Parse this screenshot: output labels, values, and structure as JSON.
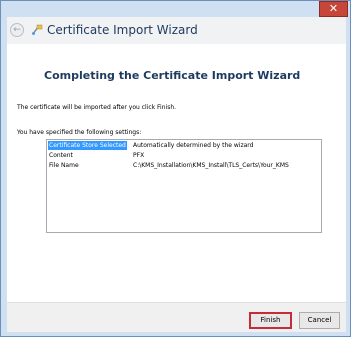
{
  "titlebar": {
    "close_glyph": "✕"
  },
  "header": {
    "back_glyph": "←",
    "title": "Certificate Import Wizard",
    "icon": "certificate-wizard-icon"
  },
  "main": {
    "heading": "Completing the Certificate Import Wizard",
    "info": "The certificate will be imported after you click Finish.",
    "settings_label": "You have specified the following settings:",
    "settings": [
      {
        "name": "Certificate Store Selected",
        "value": "Automatically determined by the wizard"
      },
      {
        "name": "Content",
        "value": "PFX"
      },
      {
        "name": "File Name",
        "value": "C:\\KMS_Installation\\KMS_Install\\TLS_Certs\\Your_KMS"
      }
    ]
  },
  "footer": {
    "finish_label": "Finish",
    "cancel_label": "Cancel"
  },
  "colors": {
    "accent": "#3399ff",
    "finish_border": "#c42b3b",
    "close": "#c7463a"
  }
}
